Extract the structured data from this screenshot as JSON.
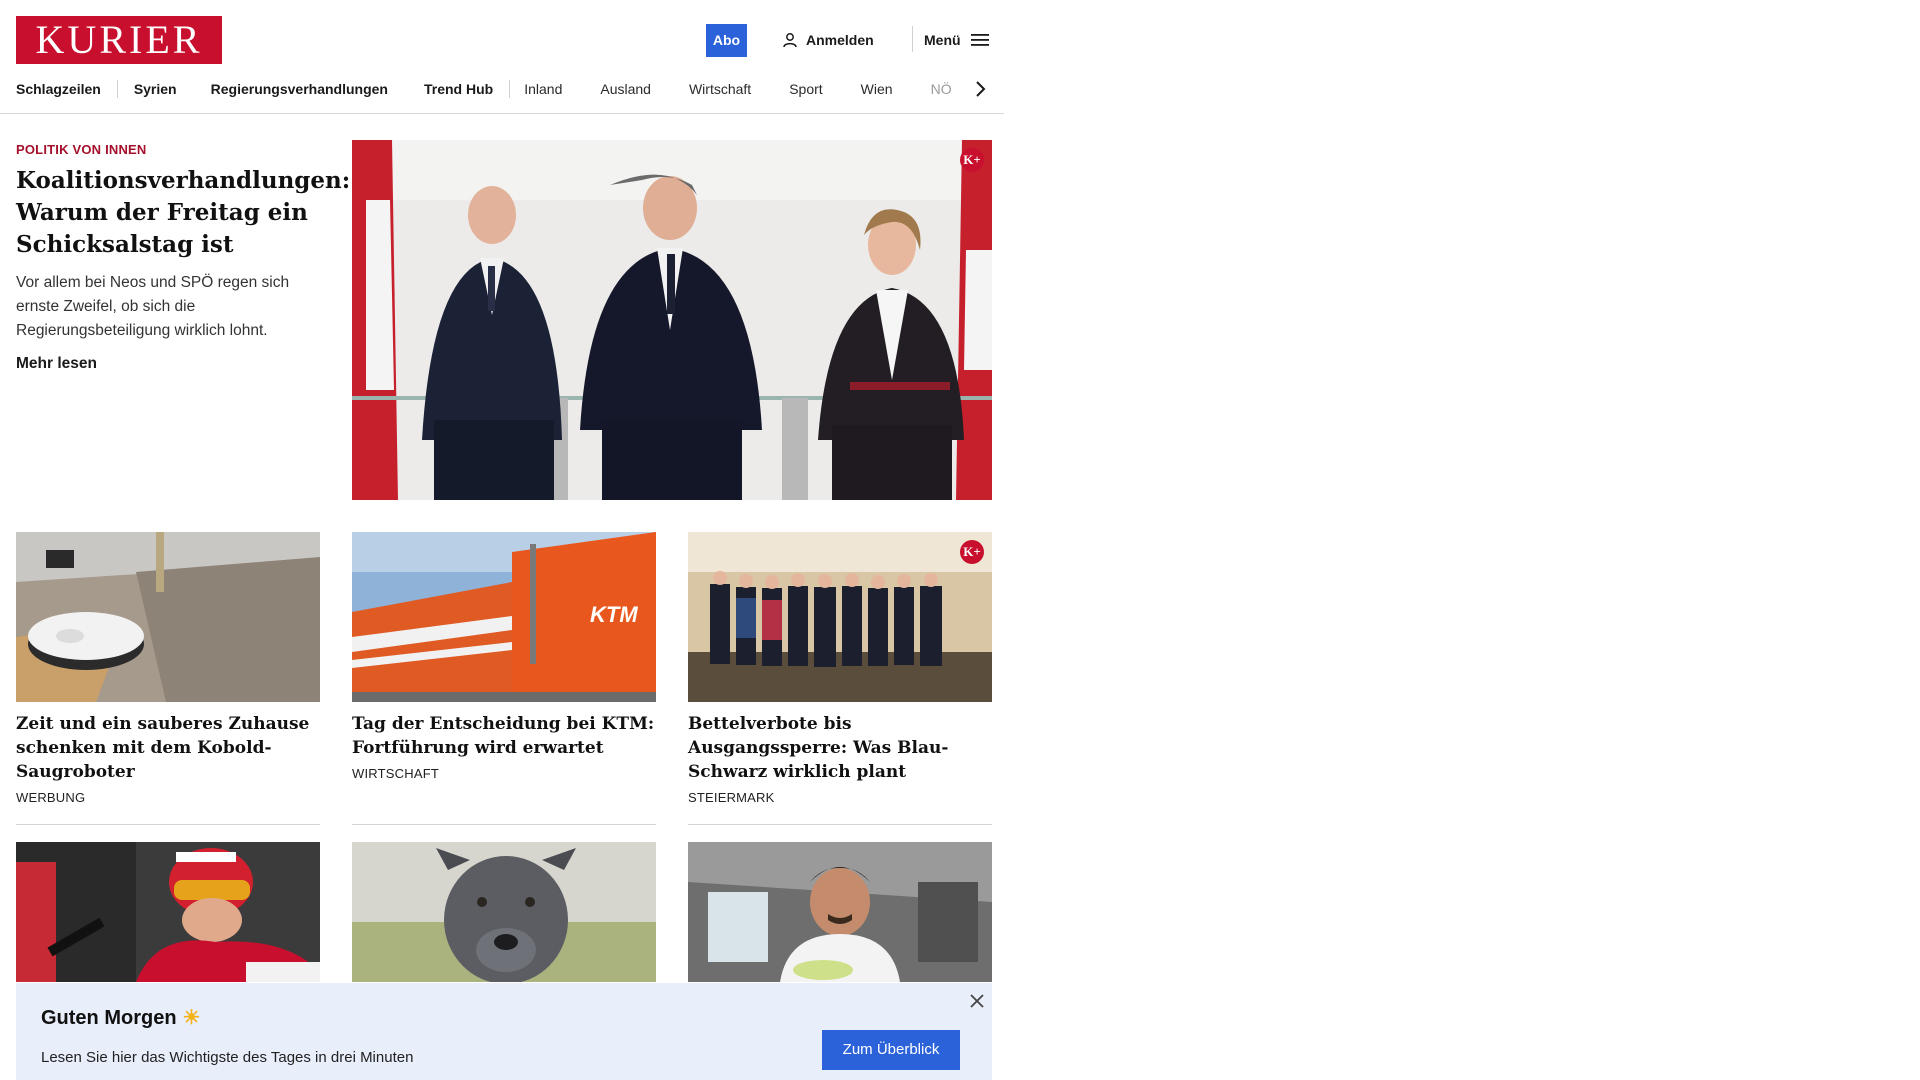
{
  "header": {
    "logo": "KURIER",
    "abo_label": "Abo",
    "login_label": "Anmelden",
    "menu_label": "Menü"
  },
  "nav": {
    "items": [
      "Schlagzeilen",
      "Syrien",
      "Regierungsverhandlungen",
      "Trend Hub",
      "Inland",
      "Ausland",
      "Wirtschaft",
      "Sport",
      "Wien",
      "NÖ"
    ]
  },
  "hero": {
    "kicker": "POLITIK VON INNEN",
    "title": "Koalitionsverhandlungen: Warum der Freitag ein Schicksalstag ist",
    "teaser": "Vor allem bei Neos und SPÖ regen sich ernste Zweifel, ob sich die Regierungsbeteiligung wirklich lohnt.",
    "read_more": "Mehr lesen",
    "badge": "K+"
  },
  "cards": [
    {
      "title": "Zeit und ein sauberes Zuhause schenken mit dem Kobold-Saugroboter",
      "tag": "WERBUNG"
    },
    {
      "title": "Tag der Entscheidung bei KTM: Fortführung wird erwartet",
      "tag": "WIRTSCHAFT"
    },
    {
      "title": "Bettelverbote bis Ausgangssperre: Was Blau-Schwarz wirklich plant",
      "tag": "STEIERMARK",
      "badge": "K+"
    }
  ],
  "banner": {
    "title": "Guten Morgen",
    "sun": "☀",
    "text": "Lesen Sie hier das Wichtigste des Tages in drei Minuten",
    "button": "Zum Überblick"
  },
  "colors": {
    "brand_red": "#c8102e",
    "accent_blue": "#2b62d9",
    "kicker_red": "#a5102a",
    "banner_bg": "#e9eefb"
  },
  "icons": [
    "user-icon",
    "hamburger-icon",
    "chevron-right-icon",
    "close-icon",
    "sun-icon"
  ]
}
